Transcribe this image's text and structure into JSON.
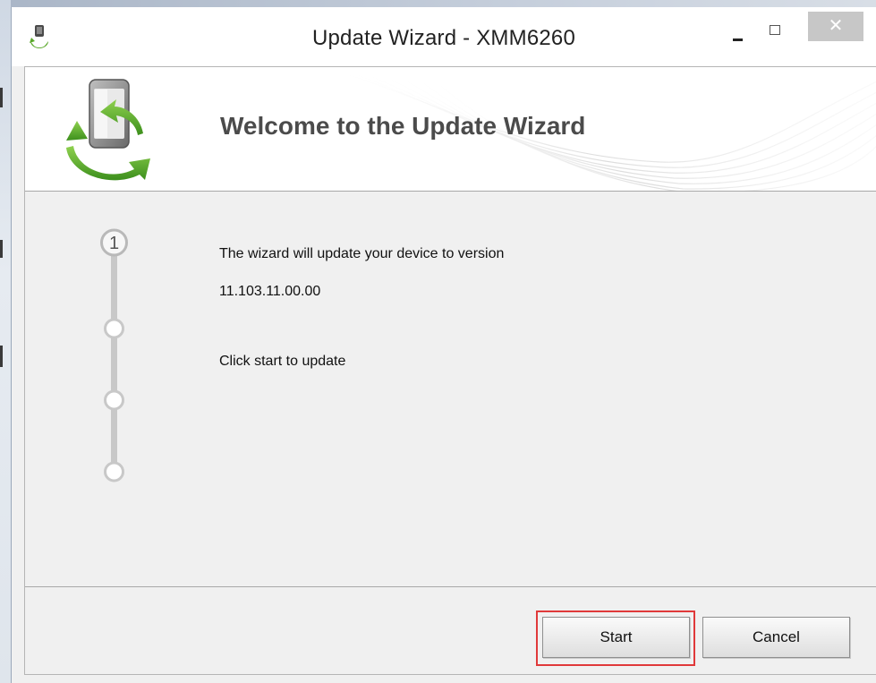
{
  "window": {
    "title": "Update Wizard - XMM6260",
    "controls": {
      "minimize_icon": "minimize-icon",
      "maximize_icon": "maximize-icon",
      "close_label": "✕"
    }
  },
  "header": {
    "title": "Welcome to the Update Wizard",
    "logo_icon": "phone-sync-icon"
  },
  "steps": {
    "current_step_label": "1",
    "total_steps": 4,
    "current_step": 1
  },
  "body": {
    "line1": "The wizard will update your device to version",
    "version": "11.103.11.00.00",
    "instruction": "Click start to update"
  },
  "footer": {
    "start_label": "Start",
    "cancel_label": "Cancel"
  },
  "colors": {
    "highlight": "#e0393a",
    "logo_green": "#5aa82a",
    "close_button": "#c7c7c7"
  }
}
